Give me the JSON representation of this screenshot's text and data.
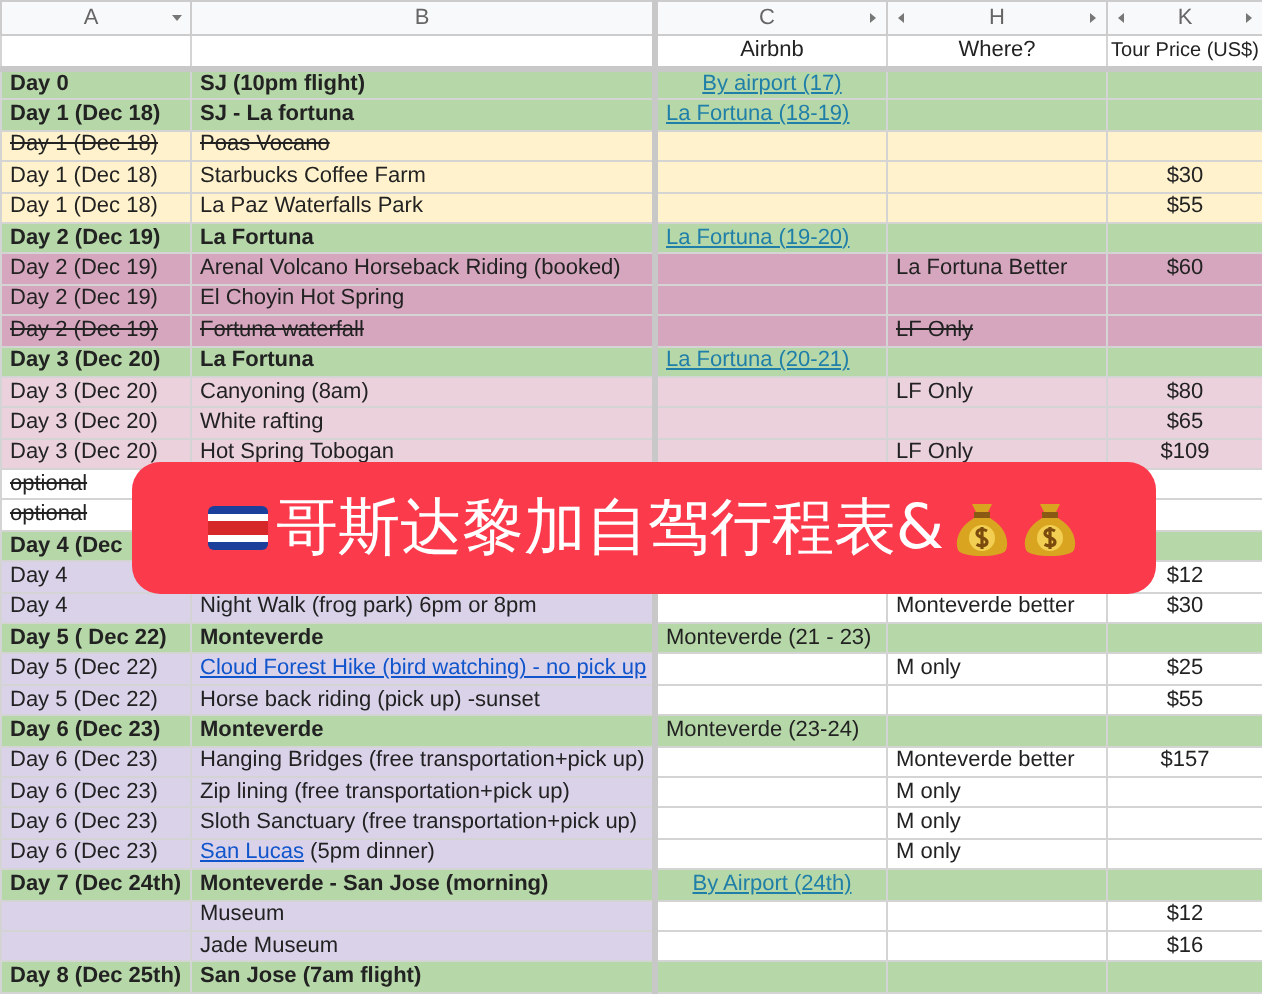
{
  "column_headers": [
    {
      "letter": "A",
      "filter": true,
      "scroll_left": false,
      "scroll_right": false
    },
    {
      "letter": "B",
      "filter": false,
      "scroll_left": false,
      "scroll_right": false
    },
    {
      "letter": "C",
      "filter": false,
      "scroll_left": false,
      "scroll_right": true
    },
    {
      "letter": "H",
      "filter": false,
      "scroll_left": true,
      "scroll_right": true
    },
    {
      "letter": "K",
      "filter": false,
      "scroll_left": true,
      "scroll_right": true
    }
  ],
  "field_labels": {
    "c": "Airbnb",
    "h": "Where?",
    "k": "Tour Price (US$)"
  },
  "rows": [
    {
      "kind": "green",
      "a": "Day 0",
      "b": "SJ (10pm flight)",
      "c": {
        "text": "By airport (17)",
        "link": true,
        "centered": true
      }
    },
    {
      "kind": "green",
      "a": "Day 1 (Dec 18)",
      "b": "SJ - La fortuna",
      "c": {
        "text": "La Fortuna (18-19)",
        "link": true
      }
    },
    {
      "kind": "yellow",
      "struck": true,
      "a": "Day 1 (Dec 18)",
      "b": "Poas Vocano"
    },
    {
      "kind": "yellow",
      "a": "Day 1 (Dec 18)",
      "b": "Starbucks Coffee Farm",
      "k": "$30"
    },
    {
      "kind": "yellow",
      "a": "Day 1 (Dec 18)",
      "b": "La Paz Waterfalls Park",
      "k": "$55"
    },
    {
      "kind": "green",
      "a": "Day 2 (Dec 19)",
      "b": "La Fortuna",
      "c": {
        "text": "La Fortuna (19-20)",
        "link": true
      }
    },
    {
      "kind": "mauve",
      "a": "Day 2 (Dec 19)",
      "b": "Arenal Volcano Horseback Riding (booked)",
      "h": "La Fortuna Better",
      "k": "$60"
    },
    {
      "kind": "mauve",
      "a": "Day 2 (Dec 19)",
      "b": "El Choyin Hot Spring"
    },
    {
      "kind": "mauve",
      "struck": true,
      "a": "Day 2 (Dec 19)",
      "b": "Fortuna waterfall",
      "h": "LF Only"
    },
    {
      "kind": "green",
      "a": "Day 3 (Dec 20)",
      "b": "La Fortuna",
      "c": {
        "text": "La Fortuna (20-21)",
        "link": true
      }
    },
    {
      "kind": "pink",
      "a": "Day 3 (Dec 20)",
      "b": "Canyoning (8am)",
      "h": "LF Only",
      "k": "$80"
    },
    {
      "kind": "pink",
      "a": "Day 3 (Dec 20)",
      "b": "White rafting",
      "k": "$65"
    },
    {
      "kind": "pink",
      "a": "Day 3 (Dec 20)",
      "b": "Hot Spring Tobogan",
      "h": "LF Only",
      "k": "$109"
    },
    {
      "kind": "white",
      "struck": true,
      "a": "optional"
    },
    {
      "kind": "white",
      "struck": true,
      "a": "optional"
    },
    {
      "kind": "green",
      "a": "Day 4 (Dec"
    },
    {
      "kind": "lavender",
      "a": "Day 4",
      "k": "$12"
    },
    {
      "kind": "lavender",
      "a": "Day 4",
      "b": "Night Walk (frog park) 6pm or 8pm",
      "h": "Monteverde better",
      "k": "$30"
    },
    {
      "kind": "green",
      "a": "Day 5 ( Dec 22)",
      "b": "Monteverde",
      "c": {
        "text": "Monteverde (21 - 23)"
      }
    },
    {
      "kind": "lavender",
      "a": "Day 5 (Dec 22)",
      "b": {
        "text": "Cloud Forest Hike (bird watching) - no pick up",
        "link": true
      },
      "h": "M only",
      "k": "$25"
    },
    {
      "kind": "lavender",
      "a": "Day 5 (Dec 22)",
      "b": "Horse back riding (pick up) -sunset",
      "k": "$55"
    },
    {
      "kind": "green",
      "a": "Day 6 (Dec 23)",
      "b": "Monteverde",
      "c": {
        "text": "Monteverde (23-24)"
      }
    },
    {
      "kind": "lavender",
      "a": "Day 6 (Dec 23)",
      "b": "Hanging Bridges (free transportation+pick up)",
      "h": "Monteverde better",
      "k": "$157"
    },
    {
      "kind": "lavender",
      "a": "Day 6 (Dec 23)",
      "b": "Zip lining (free transportation+pick up)",
      "h": "M only"
    },
    {
      "kind": "lavender",
      "a": "Day 6 (Dec 23)",
      "b": "Sloth Sanctuary (free transportation+pick up)",
      "h": "M only"
    },
    {
      "kind": "lavender",
      "a": "Day 6 (Dec 23)",
      "b": {
        "text": "San Lucas",
        "link": true,
        "after": " (5pm dinner)"
      },
      "h": "M only"
    },
    {
      "kind": "green",
      "a": "Day 7 (Dec 24th)",
      "b": "Monteverde - San Jose (morning)",
      "c": {
        "text": "By Airport (24th)",
        "link": true,
        "centered": true
      }
    },
    {
      "kind": "lavender",
      "b": "Museum",
      "k": "$12"
    },
    {
      "kind": "lavender",
      "b": "Jade Museum",
      "k": "$16"
    },
    {
      "kind": "green",
      "a": "Day 8 (Dec 25th)",
      "b": "San Jose (7am flight)"
    }
  ],
  "banner": {
    "title": "哥斯达黎加自驾行程表&"
  }
}
